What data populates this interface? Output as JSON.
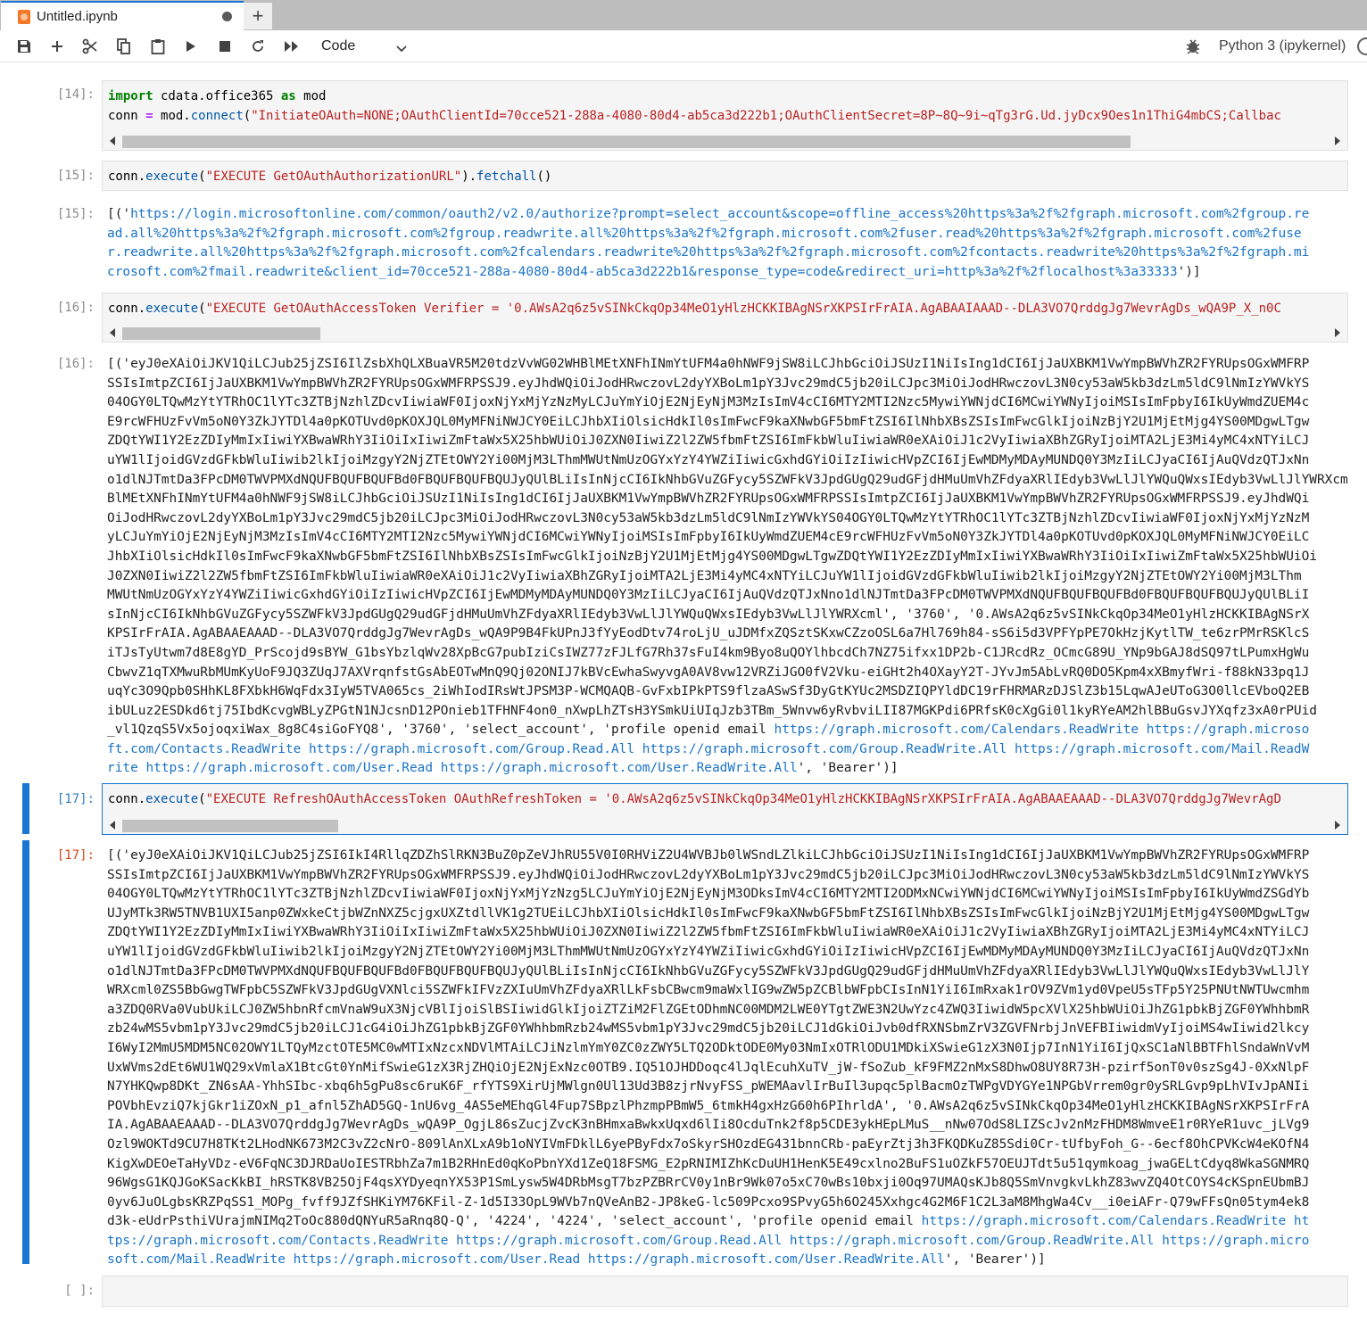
{
  "tab": {
    "title": "Untitled.ipynb",
    "new_tab_label": "+"
  },
  "toolbar": {
    "icons": [
      "save-icon",
      "add-cell-icon",
      "cut-icon",
      "copy-icon",
      "paste-icon",
      "run-icon",
      "stop-icon",
      "restart-icon",
      "restart-run-all-icon"
    ],
    "cell_type": "Code",
    "kernel_name": "Python 3 (ipykernel)"
  },
  "cells": {
    "c14": {
      "prompt": "[14]:",
      "line1": {
        "k1": "import",
        "mod1": " cdata.office365 ",
        "k2": "as",
        "mod2": " mod"
      },
      "line2": {
        "a": "conn ",
        "eq": "=",
        "b": " mod.",
        "fn": "connect",
        "c": "(",
        "s": "\"InitiateOAuth=NONE;OAuthClientId=70cce521-288a-4080-80d4-ab5ca3d222b1;OAuthClientSecret=8P~8Q~9i~qTg3rG.Ud.jyDcx9Oes1n1ThiG4mbCS;Callbac"
      }
    },
    "c15": {
      "prompt": "[15]:",
      "code": {
        "a": "conn.",
        "fn": "execute",
        "b": "(",
        "s": "\"EXECUTE GetOAuthAuthorizationURL\"",
        "c": ").",
        "fn2": "fetchall",
        "d": "()"
      },
      "out_prompt": "[15]:",
      "output": [
        {
          "pre": "[('",
          "link": "https://login.microsoftonline.com/common/oauth2/v2.0/authorize?prompt=select_account&scope=offline_access%20https%3a%2f%2fgraph.microsoft.com%2fgroup.re"
        },
        {
          "pre": "",
          "link": "ad.all%20https%3a%2f%2fgraph.microsoft.com%2fgroup.readwrite.all%20https%3a%2f%2fgraph.microsoft.com%2fuser.read%20https%3a%2f%2fgraph.microsoft.com%2fuse"
        },
        {
          "pre": "",
          "link": "r.readwrite.all%20https%3a%2f%2fgraph.microsoft.com%2fcalendars.readwrite%20https%3a%2f%2fgraph.microsoft.com%2fcontacts.readwrite%20https%3a%2f%2fgraph.mi"
        },
        {
          "pre": "",
          "link": "crosoft.com%2fmail.readwrite&client_id=70cce521-288a-4080-80d4-ab5ca3d222b1&response_type=code&redirect_uri=http%3a%2f%2flocalhost%3a33333",
          "post": "')]"
        }
      ]
    },
    "c16": {
      "prompt": "[16]:",
      "code": {
        "a": "conn.",
        "fn": "execute",
        "b": "(",
        "s": "\"EXECUTE GetOAuthAccessToken Verifier = '0.AWsA2q6z5vSINkCkqOp34MeO1yHlzHCKKIBAgNSrXKPSIrFrAIA.AgABAAIAAAD--DLA3VO7QrddgJg7WevrAgDs_wQA9P_X_n0C"
      },
      "out_prompt": "[16]:",
      "output": [
        "[('eyJ0eXAiOiJKV1QiLCJub25jZSI6IlZsbXhQLXBuaVR5M20tdzVvWG02WHBlMEtXNFhINmYtUFM4a0hNWF9jSW8iLCJhbGciOiJSUzI1NiIsIng1dCI6IjJaUXBKM1VwYmpBWVhZR2FYRUpsOGxWMFRP",
        "SSIsImtpZCI6IjJaUXBKM1VwYmpBWVhZR2FYRUpsOGxWMFRPSSJ9.eyJhdWQiOiJodHRwczovL2dyYXBoLm1pY3Jvc29mdC5jb20iLCJpc3MiOiJodHRwczovL3N0cy53aW5kb3dzLm5ldC9lNmIzYWVkYS",
        "04OGY0LTQwMzYtYTRhOC1lYTc3ZTBjNzhlZDcvIiwiaWF0IjoxNjYxMjYzNzMyLCJuYmYiOjE2NjEyNjM3MzIsImV4cCI6MTY2MTI2Nzc5MywiYWNjdCI6MCwiYWNyIjoiMSIsImFpbyI6IkUyWmdZUEM4c",
        "E9rcWFHUzFvVm5oN0Y3ZkJYTDl4a0pKOTUvd0pKOXJQL0MyMFNiNWJCY0EiLCJhbXIiOlsicHdkIl0sImFwcF9kaXNwbGF5bmFtZSI6IlNhbXBsZSIsImFwcGlkIjoiNzBjY2U1MjEtMjg4YS00MDgwLTgw",
        "ZDQtYWI1Y2EzZDIyMmIxIiwiYXBwaWRhY3IiOiIxIiwiZmFtaWx5X25hbWUiOiJ0ZXN0IiwiZ2l2ZW5fbmFtZSI6ImFkbWluIiwiaWR0eXAiOiJ1c2VyIiwiaXBhZGRyIjoiMTA2LjE3Mi4yMC4xNTYiLCJ",
        "uYW1lIjoidGVzdGFkbWluIiwib2lkIjoiMzgyY2NjZTEtOWY2Yi00MjM3LThmMWUtNmUzOGYxYzY4YWZiIiwicGxhdGYiOiIzIiwicHVpZCI6IjEwMDMyMDAyMUNDQ0Y3MzIiLCJyaCI6IjAuQVdzQTJxNn",
        "o1dlNJTmtDa3FPcDM0TWVPMXdNQUFBQUFBQUFBd0FBQUFBQUFBQUJyQUlBLiIsInNjcCI6IkNhbGVuZGFycy5SZWFkV3JpdGUgQ29udGFjdHMuUmVhZFdyaXRlIEdyb3VwLlJlYWQuQWxsIEdyb3VwLlJlYWRXcml0",
        "BlMEtXNFhINmYtUFM4a0hNWF9jSW8iLCJhbGciOiJSUzI1NiIsIng1dCI6IjJaUXBKM1VwYmpBWVhZR2FYRUpsOGxWMFRPSSIsImtpZCI6IjJaUXBKM1VwYmpBWVhZR2FYRUpsOGxWMFRPSSJ9.eyJhdWQi",
        "OiJodHRwczovL2dyYXBoLm1pY3Jvc29mdC5jb20iLCJpc3MiOiJodHRwczovL3N0cy53aW5kb3dzLm5ldC9lNmIzYWVkYS04OGY0LTQwMzYtYTRhOC1lYTc3ZTBjNzhlZDcvIiwiaWF0IjoxNjYxMjYzNzM",
        "yLCJuYmYiOjE2NjEyNjM3MzIsImV4cCI6MTY2MTI2Nzc5MywiYWNjdCI6MCwiYWNyIjoiMSIsImFpbyI6IkUyWmdZUEM4cE9rcWFHUzFvVm5oN0Y3ZkJYTDl4a0pKOTUvd0pKOXJQL0MyMFNiNWJCY0EiLC",
        "JhbXIiOlsicHdkIl0sImFwcF9kaXNwbGF5bmFtZSI6IlNhbXBsZSIsImFwcGlkIjoiNzBjY2U1MjEtMjg4YS00MDgwLTgwZDQtYWI1Y2EzZDIyMmIxIiwiYXBwaWRhY3IiOiIxIiwiZmFtaWx5X25hbWUiOi",
        "J0ZXN0IiwiZ2l2ZW5fbmFtZSI6ImFkbWluIiwiaWR0eXAiOiJ1c2VyIiwiaXBhZGRyIjoiMTA2LjE3Mi4yMC4xNTYiLCJuYW1lIjoidGVzdGFkbWluIiwib2lkIjoiMzgyY2NjZTEtOWY2Yi00MjM3LThm",
        "MWUtNmUzOGYxYzY4YWZiIiwicGxhdGYiOiIzIiwicHVpZCI6IjEwMDMyMDAyMUNDQ0Y3MzIiLCJyaCI6IjAuQVdzQTJxNno1dlNJTmtDa3FPcDM0TWVPMXdNQUFBQUFBQUFBd0FBQUFBQUFBQUJyQUlBLiI",
        "sInNjcCI6IkNhbGVuZGFycy5SZWFkV3JpdGUgQ29udGFjdHMuUmVhZFdyaXRlIEdyb3VwLlJlYWQuQWxsIEdyb3VwLlJlYWRXcml', '3760', '0.AWsA2q6z5vSINkCkqOp34MeO1yHlzHCKKIBAgNSrX",
        "KPSIrFrAIA.AgABAAEAAAD--DLA3VO7QrddgJg7WevrAgDs_wQA9P9B4FkUPnJ3fYyEodDtv74roLjU_uJDMfxZQSztSKxwCZzoOSL6a7Hl769h84-sS6i5d3VPFYpPE7OkHzjKytlTW_te6zrPMrRSKlcS",
        "iTJsTyUtwm7d8E8gYD_PrScojd9sBYW_G1bsYbzlqWv28XpBcG7pubIziCsIWZ77zFJLfG7Rh37sFuI4km9Byo8uQOYlhbcdCh7NZ75ifxx1DP2b-C1JRcdRz_OCmcG89U_YNp9bGAJ8dSQ97tLPumxHgWu",
        "CbwvZ1qTXMwuRbMUmKyUoF9JQ3ZUqJ7AXVrqnfstGsAbEOTwMnQ9Qj02ONIJ7kBVcEwhaSwyvgA0AV8vw12VRZiJGO0fV2Vku-eiGHt2h4OXayY2T-JYvJm5AbLvRQ0DO5Kpm4xXBmyfWri-f88kN33pq1J",
        "uqYc3O9Qpb0SHhKL8FXbkH6WqFdx3IyW5TVA065cs_2iWhIodIRsWtJPSM3P-WCMQAQB-GvFxbIPkPTS9flzaASwSf3DyGtKYUc2MSDZIQPYldDC19rFHRMARzDJSlZ3b15LqwAJeUToG3O0llcEVboQ2EB",
        "ibULuz2ESDkd6tj75IbdKcvgWBLyZPGtN1NJcsnD12POnieb1TFHNF4on0_nXwpLhZTsH3YSmkUiUIqJzb3TBm_5Wnvw6yRvbviLII87MGKPdi6PRfsK0cXgGi0l1kyRYeAM2hlBBuGsvJYXqfz3xA0rPUid",
        "_vl1QzqS5Vx5ojoqxiWax_8g8C4siGoFYQ8', '3760', 'select_account', 'profile openid email |LINK:https://graph.microsoft.com/Calendars.ReadWrite https://graph.microso",
        "|LINK:ft.com/Contacts.ReadWrite https://graph.microsoft.com/Group.Read.All https://graph.microsoft.com/Group.ReadWrite.All https://graph.microsoft.com/Mail.ReadW",
        "|LINK:rite https://graph.microsoft.com/User.Read https://graph.microsoft.com/User.ReadWrite.All|END:', 'Bearer')]"
      ]
    },
    "c17": {
      "prompt": "[17]:",
      "code": {
        "a": "conn.",
        "fn": "execute",
        "b": "(",
        "s": "\"EXECUTE RefreshOAuthAccessToken OAuthRefreshToken = '0.AWsA2q6z5vSINkCkqOp34MeO1yHlzHCKKIBAgNSrXKPSIrFrAIA.AgABAAEAAAD--DLA3VO7QrddgJg7WevrAgD"
      },
      "out_prompt": "[17]:",
      "output": [
        "[('eyJ0eXAiOiJKV1QiLCJub25jZSI6IkI4RllqZDZhSlRKN3BuZ0pZeVJhRU55V0I0RHViZ2U4WVBJb0lWSndLZlkiLCJhbGciOiJSUzI1NiIsIng1dCI6IjJaUXBKM1VwYmpBWVhZR2FYRUpsOGxWMFRP",
        "SSIsImtpZCI6IjJaUXBKM1VwYmpBWVhZR2FYRUpsOGxWMFRPSSJ9.eyJhdWQiOiJodHRwczovL2dyYXBoLm1pY3Jvc29mdC5jb20iLCJpc3MiOiJodHRwczovL3N0cy53aW5kb3dzLm5ldC9lNmIzYWVkYS",
        "04OGY0LTQwMzYtYTRhOC1lYTc3ZTBjNzhlZDcvIiwiaWF0IjoxNjYxMjYzNzg5LCJuYmYiOjE2NjEyNjM3ODksImV4cCI6MTY2MTI2ODMxNCwiYWNjdCI6MCwiYWNyIjoiMSIsImFpbyI6IkUyWmdZSGdYb",
        "UJyMTk3RW5TNVB1UXI5anp0ZWxkeCtjbWZnNXZ5cjgxUXZtdllVK1g2TUEiLCJhbXIiOlsicHdkIl0sImFwcF9kaXNwbGF5bmFtZSI6IlNhbXBsZSIsImFwcGlkIjoiNzBjY2U1MjEtMjg4YS00MDgwLTgw",
        "ZDQtYWI1Y2EzZDIyMmIxIiwiYXBwaWRhY3IiOiIxIiwiZmFtaWx5X25hbWUiOiJ0ZXN0IiwiZ2l2ZW5fbmFtZSI6ImFkbWluIiwiaWR0eXAiOiJ1c2VyIiwiaXBhZGRyIjoiMTA2LjE3Mi4yMC4xNTYiLCJ",
        "uYW1lIjoidGVzdGFkbWluIiwib2lkIjoiMzgyY2NjZTEtOWY2Yi00MjM3LThmMWUtNmUzOGYxYzY4YWZiIiwicGxhdGYiOiIzIiwicHVpZCI6IjEwMDMyMDAyMUNDQ0Y3MzIiLCJyaCI6IjAuQVdzQTJxNn",
        "o1dlNJTmtDa3FPcDM0TWVPMXdNQUFBQUFBQUFBd0FBQUFBQUFBQUJyQUlBLiIsInNjcCI6IkNhbGVuZGFycy5SZWFkV3JpdGUgQ29udGFjdHMuUmVhZFdyaXRlIEdyb3VwLlJlYWQuQWxsIEdyb3VwLlJlY",
        "WRXcml0ZS5BbGwgTWFpbC5SZWFkV3JpdGUgVXNlci5SZWFkIFVzZXIuUmVhZFdyaXRlLkFsbCBwcm9maWxlIG9wZW5pZCBlbWFpbCIsInN1YiI6ImRxak1rOV9ZVm1yd0VpeU5sTFp5Y25PNUtNWTUwcmhm",
        "a3ZDQ0RVa0VubUkiLCJ0ZW5hbnRfcmVnaW9uX3NjcVBlIjoiSlBSIiwidGlkIjoiZTZiM2FlZGEtODhmNC00MDM2LWE0YTgtZWE3N2UwYzc4ZWQ3IiwidW5pcXVlX25hbWUiOiJhZG1pbkBjZGF0YWhhbmR",
        "zb24wMS5vbm1pY3Jvc29mdC5jb20iLCJ1cG4iOiJhZG1pbkBjZGF0YWhhbmRzb24wMS5vbm1pY3Jvc29mdC5jb20iLCJ1dGkiOiJvb0dfRXNSbmZrV3ZGVFNrbjJnVEFBIiwidmVyIjoiMS4wIiwid2lkcy",
        "I6WyI2MmU5MDM5NC02OWY1LTQyMzctOTE5MC0wMTIxNzcxNDVlMTAiLCJiNzlmYmY0ZC0zZWY5LTQ2ODktODE0My03NmIxOTRlODU1MDkiXSwieG1zX3N0Ijp7InN1YiI6IjQxSC1aNlBBTFhlSndaWnVvM",
        "UxWVms2dEt6WU1WQ29xVmlaX1BtcGt0YnMifSwieG1zX3RjZHQiOjE2NjExNzc0OTB9.IQ51OJHDDoqc4lJqlEcuhXuTV_jW-fSoZub_kF9FMZ2nMxS8DhwO8UY8R73H-pzirf5onT0v0szSg4J-0XxNlpF",
        "N7YHKQwp8DKt_ZN6sAA-YhhSIbc-xbq6h5gPu8sc6ruK6F_rfYTS9XirUjMWlgn0Ul13Ud3B8zjrNvyFSS_pWEMAavlIrBuIl3upqc5plBacmOzTWPgVDYGYe1NPGbVrrem0gr0ySRLGvp9pLhVIvJpANIi",
        "POVbhEvziQ7kjGkr1iZOxN_p1_afnl5ZhAD5GQ-1nU6vg_4AS5eMEhqGl4Fup7SBpzlPhzmpPBmW5_6tmkH4gxHzG60h6PIhrldA', '0.AWsA2q6z5vSINkCkqOp34MeO1yHlzHCKKIBAgNSrXKPSIrFrA",
        "IA.AgABAAEAAAD--DLA3VO7QrddgJg7WevrAgDs_wQA9P_OgjL86sZucjZvcK3nBHmxaBwkxUqxd6lIi8OcduTnk2f8p5CDE3ykHEpLMuS__nNw07OdS8LIZScJv2nMzFHDM8WmveE1r0RYeR1uvc_jLVg9",
        "Ozl9WOKTd9CU7H8TKt2LHodNK673M2C3vZ2cNrO-809lAnXLxA9b1oNYIVmFDklL6yePByFdx7oSkyrSHOzdEG431bnnCRb-paEyrZtj3h3FKQDKuZ85Sdi0Cr-tUfbyFoh_G--6ecf8OhCPVKcW4eKOfN4",
        "KigXwDEOeTaHyVDz-eV6FqNC3DJRDaUoIESTRbhZa7m1B2RHnEd0qKoPbnYXd1ZeQ18FSMG_E2pRNIMIZhKcDuUH1HenK5E49cxlno2BuFS1uOZkF57OEUJTdt5u51qymkoag_jwaGELtCdyq8WkaSGNMRQ",
        "96WgsG1KQJGoKSacKkBI_hRSTK8VB25OjF4qsXYDyeqnYX53P1SmLysw5W4DRbMsgT7bzPZBRrCV0y1nBr9Wk07o5xC70wBs10bxji0Oq97UMAQsKJb8Q5SmVnvgkvLkhZ83wvZQ4OtCOYS4cKSpnEUbmBJ",
        "0yv6JuOLgbsKRZPqSS1_MOPg_fvff9JZfSHKiYM76KFil-Z-1d5I33OpL9WVb7nQVeAnB2-JP8keG-lc509Pcxo9SPvyG5h6O245Xxhgc4G2M6F1C2L3aM8MhgWa4Cv__i0eiAFr-Q79wFFsQn05tym4ek8",
        "d3k-eUdrPsthiVUrajmNIMq2ToOc880dQNYuR5aRnq8Q-Q', '4224', '4224', 'select_account', 'profile openid email |LINK:https://graph.microsoft.com/Calendars.ReadWrite ht",
        "|LINK:tps://graph.microsoft.com/Contacts.ReadWrite https://graph.microsoft.com/Group.Read.All https://graph.microsoft.com/Group.ReadWrite.All https://graph.micro",
        "|LINK:soft.com/Mail.ReadWrite https://graph.microsoft.com/User.Read https://graph.microsoft.com/User.ReadWrite.All|END:', 'Bearer')]"
      ]
    },
    "c_empty": {
      "prompt": "[ ]:"
    }
  }
}
